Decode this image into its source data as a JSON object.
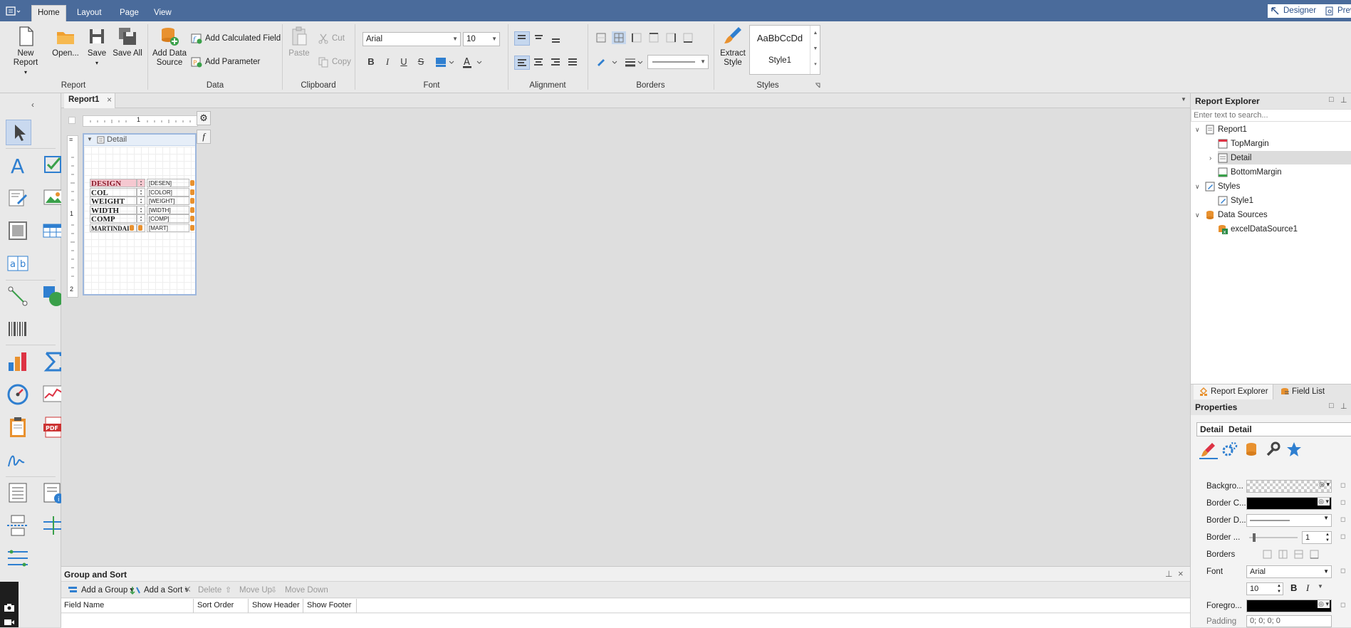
{
  "ribbon_tabs": [
    "Home",
    "Layout",
    "Page",
    "View"
  ],
  "active_tab": "Home",
  "top_buttons": {
    "designer": "Designer",
    "preview": "Previ"
  },
  "report_group": {
    "label": "Report",
    "new_report": "New Report",
    "open": "Open...",
    "save": "Save",
    "save_all": "Save All"
  },
  "data_group": {
    "label": "Data",
    "add_data_source_1": "Add Data",
    "add_data_source_2": "Source",
    "add_calculated_field": "Add Calculated Field",
    "add_parameter": "Add Parameter"
  },
  "clipboard_group": {
    "label": "Clipboard",
    "paste": "Paste",
    "cut": "Cut",
    "copy": "Copy"
  },
  "font_group": {
    "label": "Font",
    "font_name": "Arial",
    "font_size": "10",
    "bold": "B",
    "italic": "I",
    "underline": "U",
    "strike": "S",
    "font_color": "A"
  },
  "alignment_group": {
    "label": "Alignment"
  },
  "borders_group": {
    "label": "Borders"
  },
  "styles_group": {
    "label": "Styles",
    "extract_1": "Extract",
    "extract_2": "Style",
    "sample_text": "AaBbCcDd",
    "style_name": "Style1"
  },
  "document_tab": "Report1",
  "report": {
    "band_name": "Detail",
    "ruler_mark_h": "1",
    "ruler_marks_v": [
      "1",
      "2"
    ],
    "rows": [
      {
        "label": "DESIGN",
        "sep": ":",
        "field": "[DESEN]"
      },
      {
        "label": "COL",
        "sep": ":",
        "field": "[COLOR]"
      },
      {
        "label": "WEIGHT",
        "sep": ":",
        "field": "[WEIGHT]"
      },
      {
        "label": "WIDTH",
        "sep": ":",
        "field": "[WIDTH]"
      },
      {
        "label": "COMP",
        "sep": ":",
        "field": "[COMP]"
      },
      {
        "label": "MARTINDAI",
        "sep": "",
        "field": "[MART]"
      }
    ]
  },
  "group_sort": {
    "title": "Group and Sort",
    "add_group": "Add a Group",
    "add_sort": "Add a Sort",
    "delete": "Delete",
    "move_up": "Move Up",
    "move_down": "Move Down",
    "columns": [
      "Field Name",
      "Sort Order",
      "Show Header",
      "Show Footer"
    ]
  },
  "report_explorer": {
    "title": "Report Explorer",
    "search_placeholder": "Enter text to search...",
    "tree": {
      "report": "Report1",
      "top_margin": "TopMargin",
      "detail": "Detail",
      "bottom_margin": "BottomMargin",
      "styles": "Styles",
      "style1": "Style1",
      "data_sources": "Data Sources",
      "excel_source": "excelDataSource1"
    },
    "tabs": [
      "Report Explorer",
      "Field List"
    ]
  },
  "properties": {
    "title": "Properties",
    "selected_name": "Detail",
    "selected_type": "Detail",
    "rows": {
      "background": "Backgro...",
      "border_color": "Border C...",
      "border_dash": "Border D...",
      "border_width": "Border ...",
      "border_width_value": "1",
      "borders": "Borders",
      "font": "Font",
      "font_value": "Arial",
      "font_size": "10",
      "font_bold": "B",
      "font_italic": "I",
      "foreground": "Foregro...",
      "padding": "Padding",
      "padding_value": "0; 0; 0; 0"
    }
  },
  "colors": {
    "accent": "#4a6b9b",
    "chrome": "#e9e9e9",
    "selection": "#c9d9ef",
    "orange": "#e8912f",
    "blue": "#2f7fd0"
  }
}
